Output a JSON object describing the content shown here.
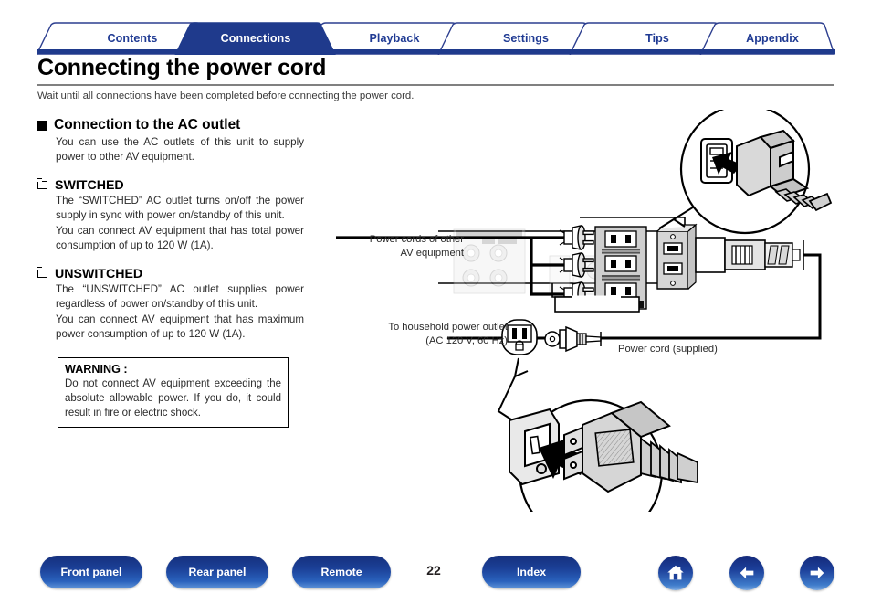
{
  "tabs": [
    {
      "label": "Contents",
      "active": false
    },
    {
      "label": "Connections",
      "active": true
    },
    {
      "label": "Playback",
      "active": false
    },
    {
      "label": "Settings",
      "active": false
    },
    {
      "label": "Tips",
      "active": false
    },
    {
      "label": "Appendix",
      "active": false
    }
  ],
  "header": {
    "title": "Connecting the power cord",
    "lede": "Wait until all connections have been completed before connecting the power cord."
  },
  "sections": {
    "ac_outlet": {
      "heading": "Connection to the AC outlet",
      "body": "You can use the AC outlets of this unit to supply power to other AV equipment."
    },
    "switched": {
      "heading": "SWITCHED",
      "body": "The “SWITCHED” AC outlet turns on/off the power supply in sync with power on/standby of this unit.\nYou can connect AV equipment that has total power consumption of up to 120 W (1A)."
    },
    "unswitched": {
      "heading": "UNSWITCHED",
      "body": "The “UNSWITCHED” AC outlet supplies power regardless of power on/standby of this unit.\nYou can connect AV equipment that has maximum power consumption of up to 120 W (1A)."
    },
    "warning": {
      "title": "WARNING :",
      "text": "Do not connect AV equipment exceeding the absolute allowable power. If you do, it could result in fire or electric shock."
    }
  },
  "diagram": {
    "label_power_cords": "Power cords of other\nAV equipment",
    "label_household_outlet": "To household power outlet\n(AC 120 V, 60 Hz)",
    "label_power_cord_supplied": "Power cord (supplied)"
  },
  "footer": {
    "front_panel": "Front panel",
    "rear_panel": "Rear panel",
    "remote": "Remote",
    "index": "Index",
    "page_number": "22",
    "home_icon": "home-icon",
    "prev_icon": "arrow-left-icon",
    "next_icon": "arrow-right-icon"
  },
  "colors": {
    "brand_navy": "#1f3a8c",
    "tab_text": "#1f3a93",
    "button_gradient_top": "#15307d",
    "button_gradient_bottom": "#5f93d8"
  }
}
